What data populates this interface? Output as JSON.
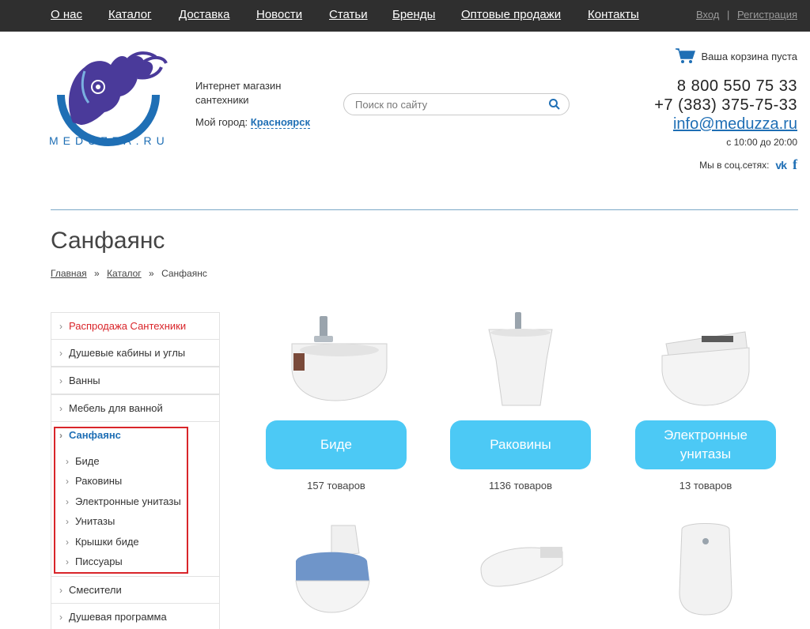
{
  "nav": {
    "items": [
      "О нас",
      "Каталог",
      "Доставка",
      "Новости",
      "Статьи",
      "Бренды",
      "Оптовые продажи",
      "Контакты"
    ],
    "login": "Вход",
    "separator": "|",
    "register": "Регистрация"
  },
  "header": {
    "logo_text": "MEDUZZA.RU",
    "description": "Интернет магазин сантехники",
    "city_label": "Мой город:",
    "city": "Красноярск",
    "search_placeholder": "Поиск по сайту",
    "cart": "Ваша корзина пуста",
    "phone1": "8 800 550 75 33",
    "phone2": "+7 (383) 375-75-33",
    "email": "info@meduzza.ru",
    "hours": "с 10:00 до 20:00",
    "social_label": "Мы в соц.сетях:"
  },
  "page": {
    "title": "Санфаянс",
    "breadcrumb": [
      "Главная",
      "Каталог",
      "Санфаянс"
    ],
    "breadcrumb_sep": "»"
  },
  "sidebar": {
    "items": [
      {
        "label": "Распродажа Сантехники"
      },
      {
        "label": "Душевые кабины и углы"
      },
      {
        "label": "Ванны"
      },
      {
        "label": "Мебель для ванной"
      },
      {
        "label": "Санфаянс"
      },
      {
        "label": "Смесители"
      },
      {
        "label": "Душевая программа"
      }
    ],
    "sub_items": [
      "Биде",
      "Раковины",
      "Электронные унитазы",
      "Унитазы",
      "Крышки биде",
      "Писсуары"
    ]
  },
  "categories": [
    {
      "name": "Биде",
      "count": "157 товаров"
    },
    {
      "name": "Раковины",
      "count": "1136 товаров"
    },
    {
      "name": "Электронные унитазы",
      "count": "13 товаров"
    }
  ],
  "colors": {
    "accent": "#4cc9f5",
    "link": "#1f6fb5",
    "highlight": "#d9252a",
    "topbar": "#2f2f2f"
  }
}
